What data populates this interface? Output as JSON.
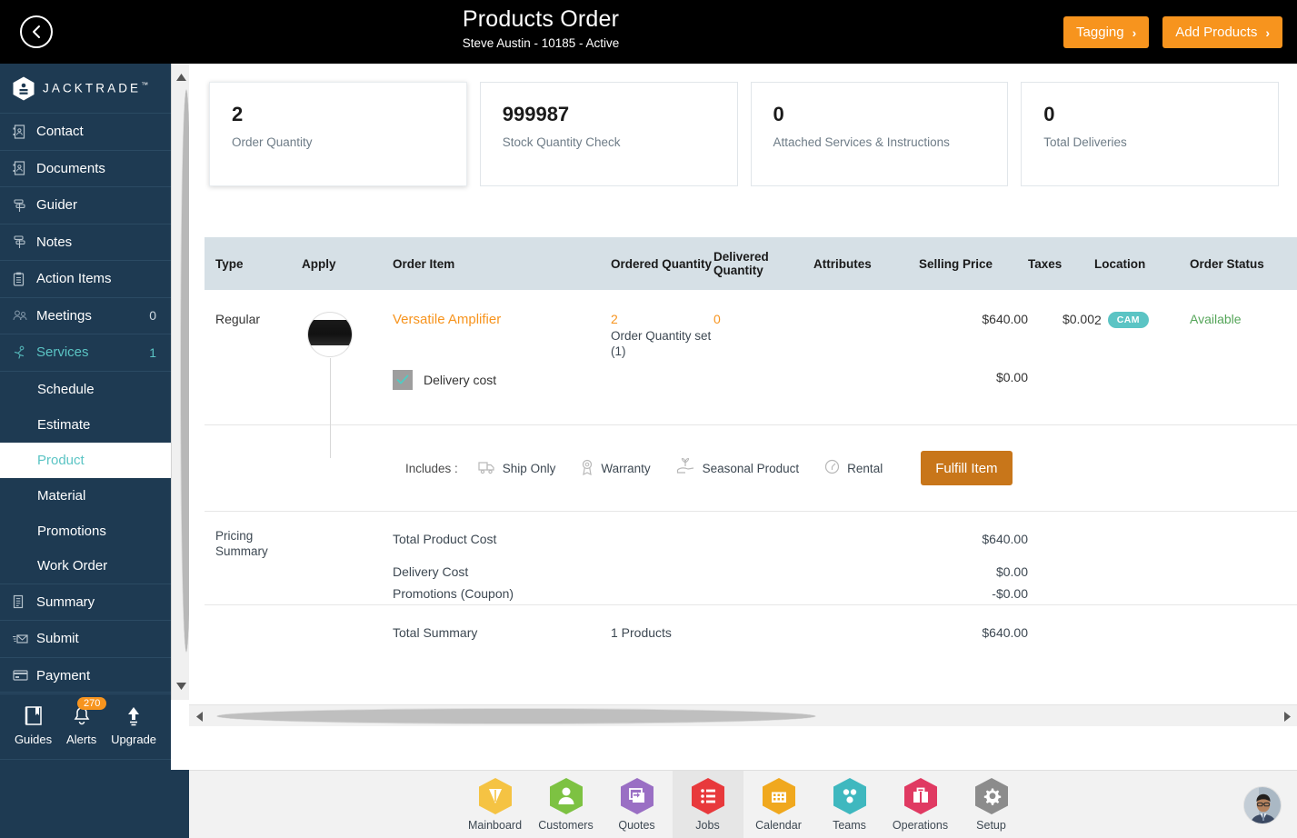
{
  "topbar": {
    "back_icon": "chevron-left-icon",
    "title": "Products Order",
    "subtitle": "Steve Austin - 10185 - Active",
    "tagging_label": "Tagging",
    "add_products_label": "Add Products",
    "chevron": "›",
    "accent_color": "#f7941e",
    "bg_color": "#000000"
  },
  "sidebar": {
    "brand": "JACKTRADE",
    "brand_tm": "™",
    "bg_color": "#1e3a52",
    "accent_color": "#5bc4c4",
    "items": [
      {
        "label": "Contact",
        "icon": "contact-book-icon",
        "count": ""
      },
      {
        "label": "Documents",
        "icon": "documents-icon",
        "count": ""
      },
      {
        "label": "Guider",
        "icon": "guider-icon",
        "count": ""
      },
      {
        "label": "Notes",
        "icon": "notes-icon",
        "count": ""
      },
      {
        "label": "Action Items",
        "icon": "clipboard-icon",
        "count": ""
      },
      {
        "label": "Meetings",
        "icon": "meetings-icon",
        "count": "0"
      },
      {
        "label": "Services",
        "icon": "services-icon",
        "count": "1",
        "active": true
      }
    ],
    "sub_items": [
      {
        "label": "Schedule",
        "active": false
      },
      {
        "label": "Estimate",
        "active": false
      },
      {
        "label": "Product",
        "active": true
      },
      {
        "label": "Material",
        "active": false
      },
      {
        "label": "Promotions",
        "active": false
      },
      {
        "label": "Work Order",
        "active": false
      }
    ],
    "items_after": [
      {
        "label": "Summary",
        "icon": "summary-icon",
        "count": ""
      },
      {
        "label": "Submit",
        "icon": "submit-icon",
        "count": ""
      },
      {
        "label": "Payment",
        "icon": "payment-card-icon",
        "count": ""
      }
    ],
    "utility": [
      {
        "label": "Guides",
        "icon": "book-icon",
        "badge": ""
      },
      {
        "label": "Alerts",
        "icon": "bell-icon",
        "badge": "270"
      },
      {
        "label": "Upgrade",
        "icon": "arrow-up-icon",
        "badge": ""
      }
    ],
    "hex_shortcuts": [
      {
        "icon": "person-icon",
        "color": "#5bc4c4"
      },
      {
        "icon": "dollar-icon",
        "color": "#5bc4c4"
      },
      {
        "icon": "payment-icon",
        "color": "#5bc4c4"
      },
      {
        "icon": "workflow-icon",
        "color": "#5bc4c4"
      }
    ]
  },
  "cards": [
    {
      "value": "2",
      "label": "Order Quantity"
    },
    {
      "value": "999987",
      "label": "Stock Quantity Check"
    },
    {
      "value": "0",
      "label": "Attached Services & Instructions"
    },
    {
      "value": "0",
      "label": "Total Deliveries"
    }
  ],
  "table": {
    "headers": [
      "Type",
      "Apply",
      "Order Item",
      "Ordered Quantity",
      "Delivered Quantity",
      "Attributes",
      "Selling Price",
      "Taxes",
      "Location",
      "Order Status"
    ],
    "row": {
      "type": "Regular",
      "thumbnail": "product-thumbnail",
      "order_item": "Versatile Amplifier",
      "ordered_quantity": "2",
      "ordered_quantity_sub": "Order Quantity set (1)",
      "delivered_quantity": "0",
      "attributes": "",
      "selling_price": "$640.00",
      "taxes": "$0.00",
      "location_count": "2",
      "location_pill": "CAM",
      "order_status": "Available",
      "status_color": "#55a559"
    },
    "delivery": {
      "label": "Delivery cost",
      "checked": true,
      "amount": "$0.00"
    },
    "includes": {
      "label": "Includes :",
      "options": [
        {
          "label": "Ship Only",
          "icon": "truck-icon"
        },
        {
          "label": "Warranty",
          "icon": "badge-ribbon-icon"
        },
        {
          "label": "Seasonal Product",
          "icon": "hand-plant-icon"
        },
        {
          "label": "Rental",
          "icon": "rental-clock-icon"
        }
      ],
      "fulfill_label": "Fulfill Item",
      "fulfill_color": "#c8761a"
    },
    "pricing_summary": {
      "title_line1": "Pricing",
      "title_line2": "Summary",
      "lines": [
        {
          "label": "Total Product Cost",
          "amount": "$640.00"
        },
        {
          "label": "Delivery Cost",
          "amount": "$0.00"
        },
        {
          "label": "Promotions (Coupon)",
          "amount": "-$0.00"
        }
      ]
    },
    "total_summary": {
      "label": "Total Summary",
      "count": "1 Products",
      "amount": "$640.00"
    }
  },
  "bottom_nav": [
    {
      "label": "Mainboard",
      "icon": "mainboard-icon",
      "color": "#f5c343",
      "active": false
    },
    {
      "label": "Customers",
      "icon": "customers-icon",
      "color": "#7dc242",
      "active": false
    },
    {
      "label": "Quotes",
      "icon": "quotes-icon",
      "color": "#9a6fc4",
      "active": false
    },
    {
      "label": "Jobs",
      "icon": "jobs-icon",
      "color": "#e8393c",
      "active": true
    },
    {
      "label": "Calendar",
      "icon": "calendar-icon",
      "color": "#f0a81e",
      "active": false
    },
    {
      "label": "Teams",
      "icon": "teams-icon",
      "color": "#3fb8bf",
      "active": false
    },
    {
      "label": "Operations",
      "icon": "operations-icon",
      "color": "#e03a62",
      "active": false
    },
    {
      "label": "Setup",
      "icon": "setup-gear-icon",
      "color": "#8c8c8c",
      "active": false
    }
  ],
  "user_avatar": "user-avatar"
}
